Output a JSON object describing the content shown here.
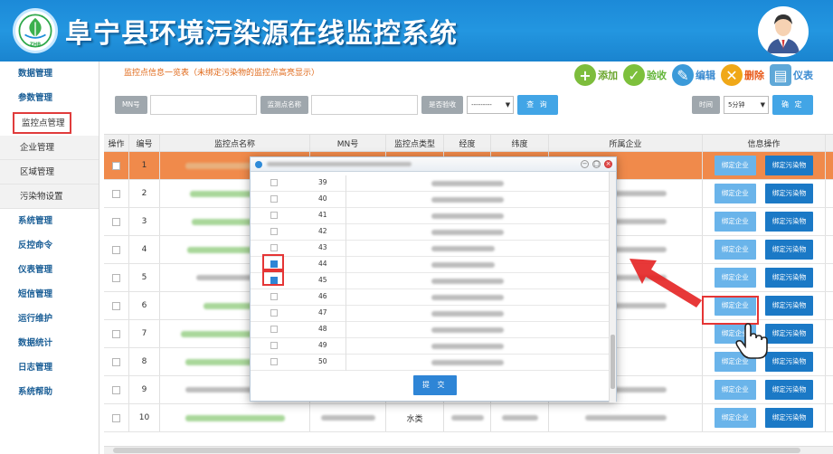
{
  "header": {
    "title": "阜宁县环境污染源在线监控系统",
    "logo_text": "ZHB"
  },
  "sidebar": {
    "items": [
      {
        "label": "数据管理",
        "type": "group"
      },
      {
        "label": "参数管理",
        "type": "group"
      },
      {
        "label": "监控点管理",
        "type": "active"
      },
      {
        "label": "企业管理",
        "type": "sub"
      },
      {
        "label": "区域管理",
        "type": "sub"
      },
      {
        "label": "污染物设置",
        "type": "sub"
      },
      {
        "label": "系统管理",
        "type": "group"
      },
      {
        "label": "反控命令",
        "type": "group"
      },
      {
        "label": "仪表管理",
        "type": "group"
      },
      {
        "label": "短信管理",
        "type": "group"
      },
      {
        "label": "运行维护",
        "type": "group"
      },
      {
        "label": "数据统计",
        "type": "group"
      },
      {
        "label": "日志管理",
        "type": "group"
      },
      {
        "label": "系统帮助",
        "type": "group"
      }
    ]
  },
  "main": {
    "list_title": "监控点信息一览表（未绑定污染物的监控点高亮显示）",
    "toolbar": {
      "add": "添加",
      "check": "验收",
      "edit": "编辑",
      "delete": "删除",
      "meter": "仪表"
    },
    "search": {
      "mn_label": "MN号",
      "name_label": "监测点名称",
      "accepted_label": "是否验收",
      "accepted_value": "---------",
      "query_button": "查 询",
      "time_label": "时间",
      "time_value": "5分钟",
      "confirm_button": "确 定"
    },
    "columns": [
      "操作",
      "编号",
      "监控点名称",
      "MN号",
      "监控点类型",
      "经度",
      "纬度",
      "所属企业",
      "信息操作"
    ],
    "rows": [
      {
        "no": "1",
        "type": ""
      },
      {
        "no": "2",
        "type": ""
      },
      {
        "no": "3",
        "type": ""
      },
      {
        "no": "4",
        "type": ""
      },
      {
        "no": "5",
        "type": ""
      },
      {
        "no": "6",
        "type": ""
      },
      {
        "no": "7",
        "type": ""
      },
      {
        "no": "8",
        "type": ""
      },
      {
        "no": "9",
        "type": ""
      },
      {
        "no": "10",
        "type": "水类"
      }
    ],
    "bind_company": "绑定企业",
    "bind_pollutant": "绑定污染物"
  },
  "dialog": {
    "rows": [
      {
        "num": "39",
        "checked": false
      },
      {
        "num": "40",
        "checked": false
      },
      {
        "num": "41",
        "checked": false
      },
      {
        "num": "42",
        "checked": false
      },
      {
        "num": "43",
        "checked": false
      },
      {
        "num": "44",
        "checked": true
      },
      {
        "num": "45",
        "checked": true
      },
      {
        "num": "46",
        "checked": false
      },
      {
        "num": "47",
        "checked": false
      },
      {
        "num": "48",
        "checked": false
      },
      {
        "num": "49",
        "checked": false
      },
      {
        "num": "50",
        "checked": false
      }
    ],
    "submit": "提 交"
  },
  "colors": {
    "header_blue": "#1c8ad8",
    "highlight_row": "#f08a4b",
    "annotation_red": "#e53535",
    "bind_company": "#6ab4ea",
    "bind_pollutant": "#1b79c6"
  }
}
